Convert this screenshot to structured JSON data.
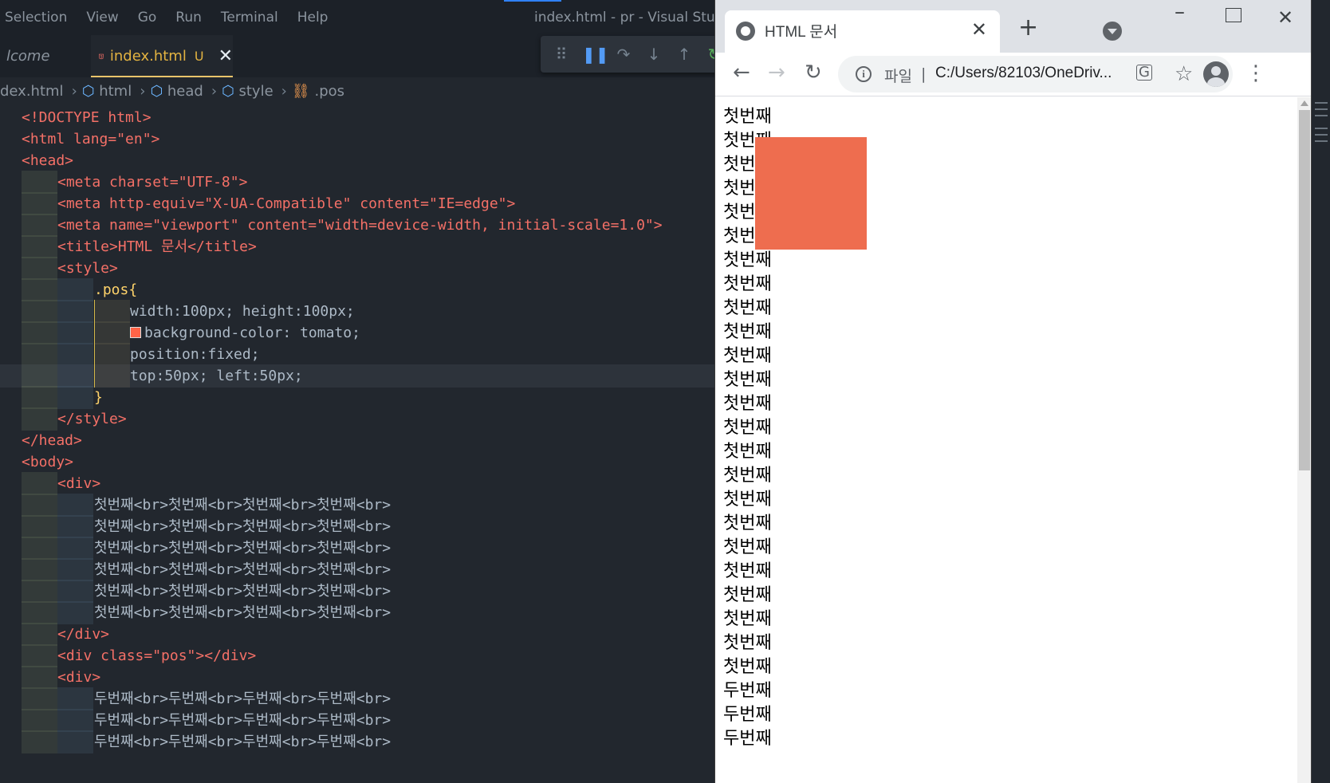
{
  "vscode": {
    "menu": [
      "Selection",
      "View",
      "Go",
      "Run",
      "Terminal",
      "Help"
    ],
    "window_title": "index.html - pr - Visual Studi",
    "tabs": [
      {
        "label": "lcome"
      },
      {
        "label": "index.html",
        "badge": "U",
        "close": "✕"
      }
    ],
    "breadcrumb": [
      "dex.html",
      "html",
      "head",
      "style",
      ".pos"
    ],
    "code": [
      "<!DOCTYPE html>",
      "<html lang=\"en\">",
      "<head>",
      "<meta charset=\"UTF-8\">",
      "<meta http-equiv=\"X-UA-Compatible\" content=\"IE=edge\">",
      "<meta name=\"viewport\" content=\"width=device-width, initial-scale=1.0\">",
      "<title>HTML 문서</title>",
      "<style>",
      ".pos{",
      "width:100px; height:100px;",
      "background-color: tomato;",
      "position:fixed;",
      "top:50px; left:50px;",
      "}",
      "</style>",
      "</head>",
      "<body>",
      "<div>",
      "첫번째<br>첫번째<br>첫번째<br>첫번째<br>",
      "첫번째<br>첫번째<br>첫번째<br>첫번째<br>",
      "첫번째<br>첫번째<br>첫번째<br>첫번째<br>",
      "첫번째<br>첫번째<br>첫번째<br>첫번째<br>",
      "첫번째<br>첫번째<br>첫번째<br>첫번째<br>",
      "첫번째<br>첫번째<br>첫번째<br>첫번째<br>",
      "</div>",
      "<div class=\"pos\"></div>",
      "<div>",
      "두번째<br>두번째<br>두번째<br>두번째<br>",
      "두번째<br>두번째<br>두번째<br>두번째<br>",
      "두번째<br>두번째<br>두번째<br>두번째<br>"
    ]
  },
  "chrome": {
    "tab_title": "HTML 문서",
    "tab_close": "✕",
    "new_tab": "+",
    "omnibox": {
      "scheme": "파일",
      "separator": "|",
      "url": "C:/Users/82103/OneDriv..."
    },
    "page_lines": [
      "첫번째",
      "첫번째",
      "첫번째",
      "첫번째",
      "첫번째",
      "첫번째",
      "첫번째",
      "첫번째",
      "첫번째",
      "첫번째",
      "첫번째",
      "첫번째",
      "첫번째",
      "첫번째",
      "첫번째",
      "첫번째",
      "첫번째",
      "첫번째",
      "첫번째",
      "첫번째",
      "첫번째",
      "첫번째",
      "첫번째",
      "첫번째",
      "두번째",
      "두번째",
      "두번째"
    ],
    "pos_box_color": "#ee6d4f"
  },
  "colors": {
    "editor_bg": "#22272e",
    "tag": "#f47067",
    "attribute": "#f69d50",
    "string": "#96d0ff",
    "css_selector": "#ffd36a"
  }
}
